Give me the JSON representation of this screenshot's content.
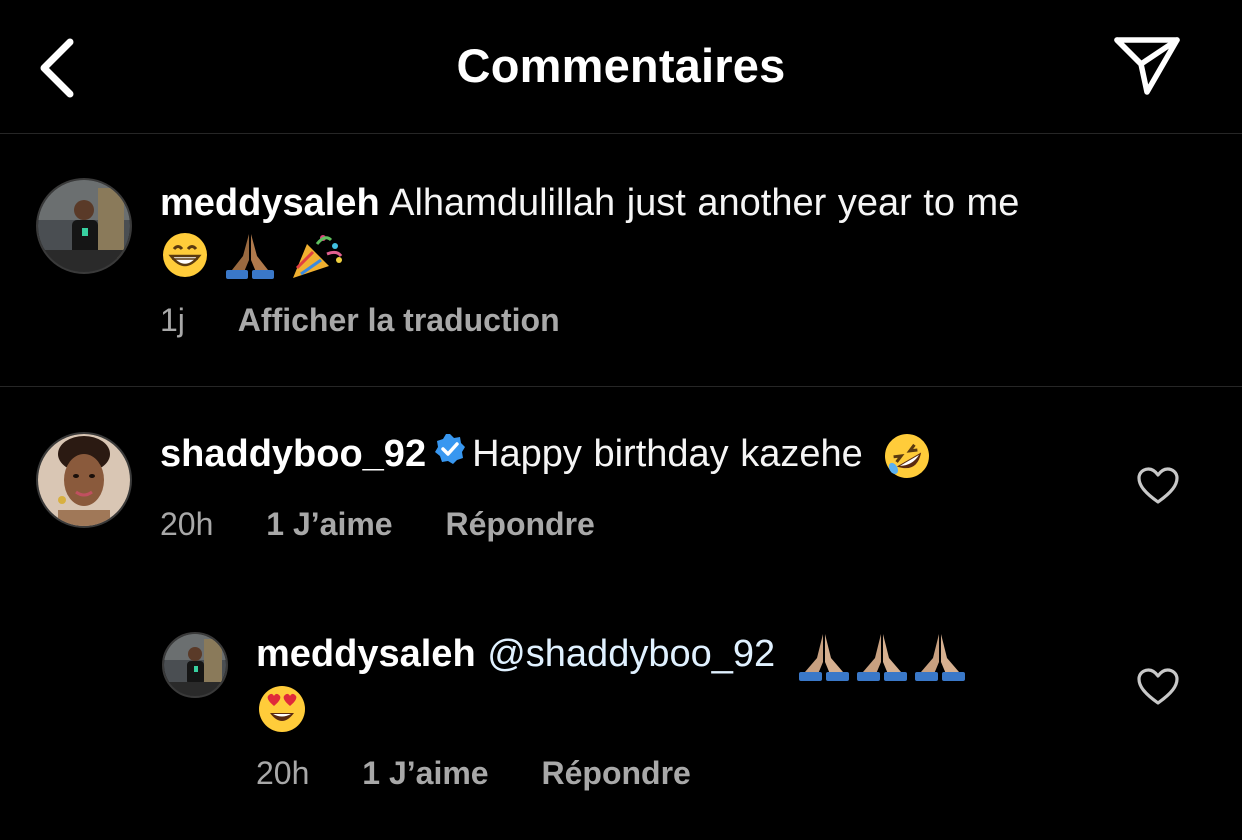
{
  "header": {
    "title": "Commentaires",
    "back_icon": "chevron-left-icon",
    "share_icon": "paper-plane-icon"
  },
  "caption": {
    "username": "meddysaleh",
    "text": "Alhamdulillah just another year to me",
    "emojis": [
      "grinning-face-emoji",
      "folded-hands-emoji",
      "party-popper-emoji"
    ],
    "time": "1j",
    "translate_label": "Afficher la traduction"
  },
  "comments": [
    {
      "username": "shaddyboo_92",
      "verified": true,
      "text": "Happy birthday kazehe",
      "emojis": [
        "rolling-laughing-emoji"
      ],
      "time": "20h",
      "likes_label": "1 J’aime",
      "reply_label": "Répondre"
    },
    {
      "username": "meddysaleh",
      "mention": "@shaddyboo_92",
      "emojis": [
        "folded-hands-emoji",
        "folded-hands-emoji",
        "folded-hands-emoji",
        "heart-eyes-emoji"
      ],
      "time": "20h",
      "likes_label": "1 J’aime",
      "reply_label": "Répondre"
    }
  ],
  "colors": {
    "background": "#000000",
    "divider": "#262626",
    "secondary_text": "#a8a8a8",
    "verified_badge": "#3897f0"
  }
}
